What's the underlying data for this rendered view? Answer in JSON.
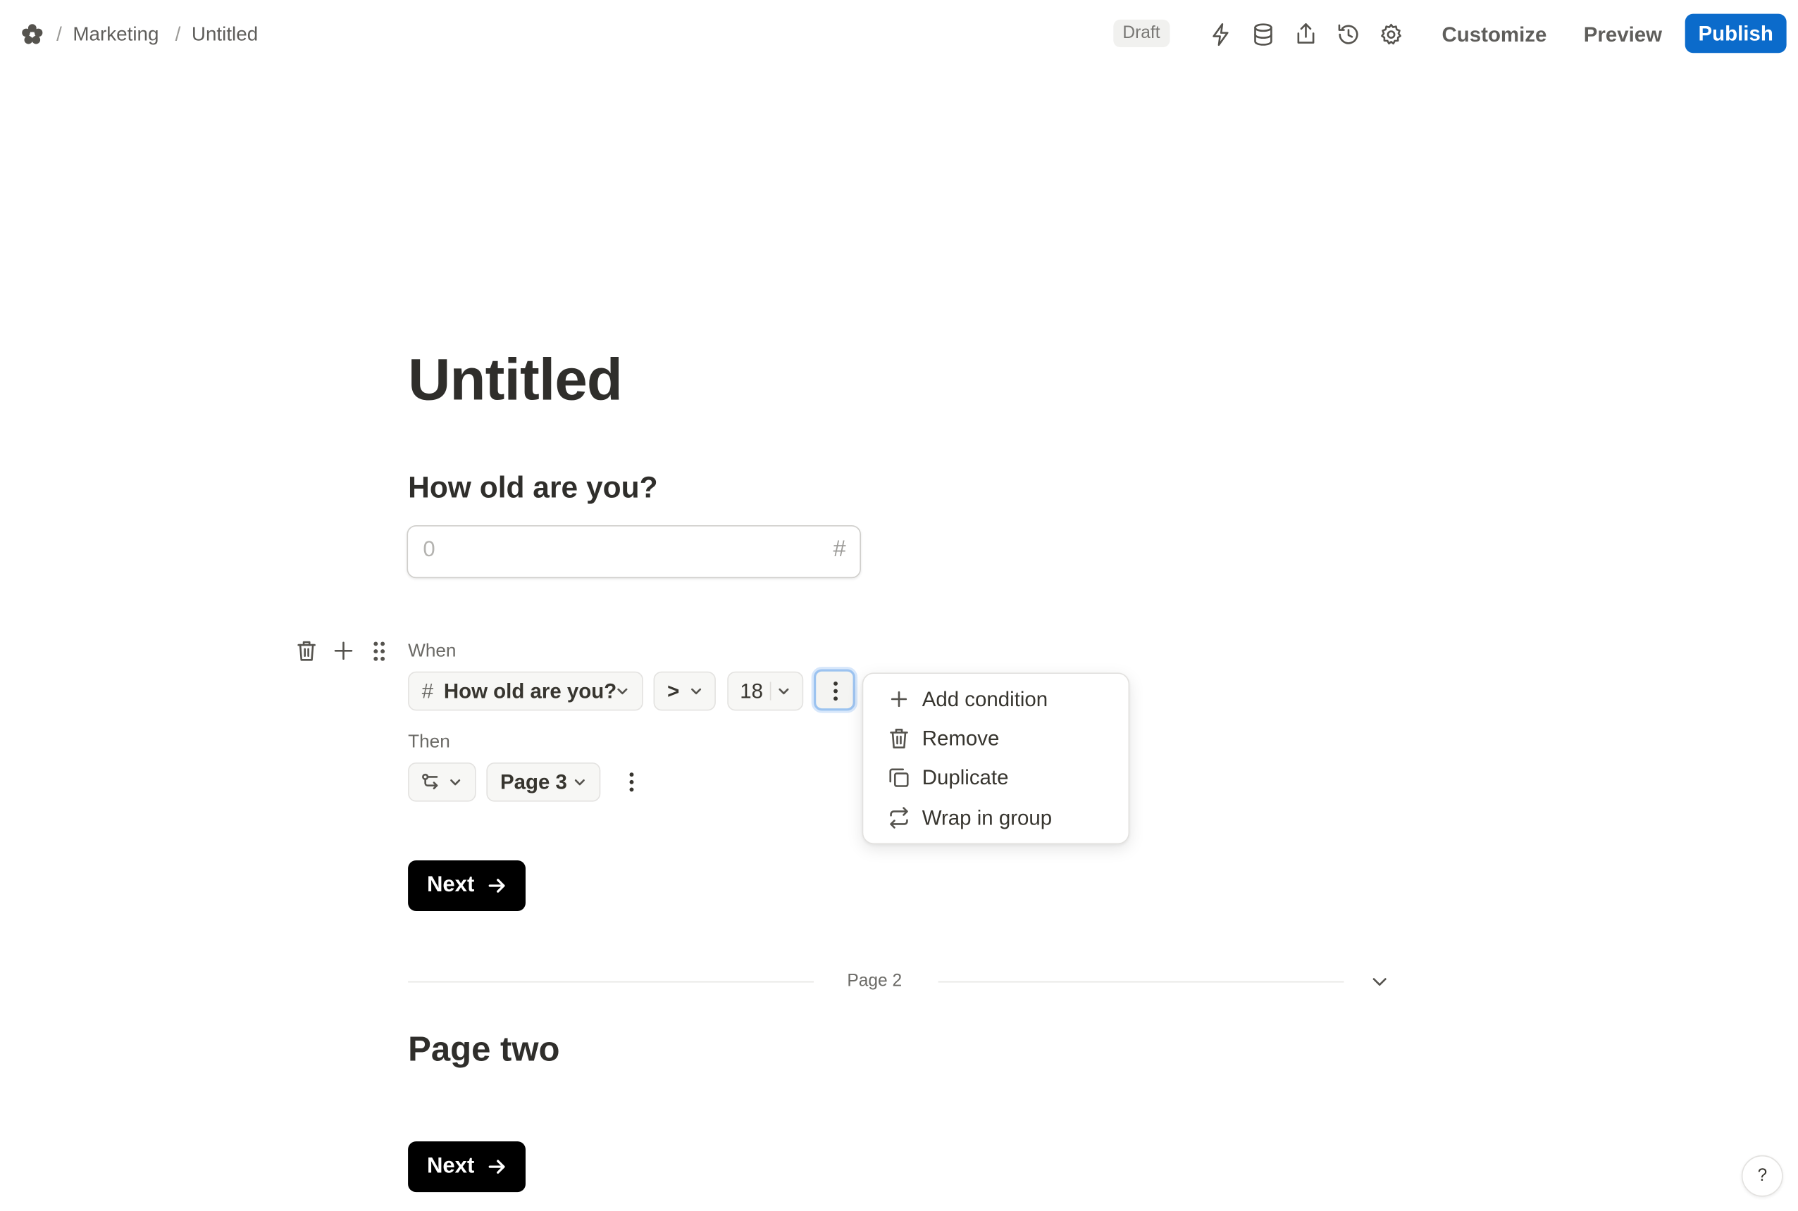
{
  "breadcrumb": {
    "workspace": "Marketing",
    "page": "Untitled"
  },
  "toolbar": {
    "status": "Draft",
    "customize_label": "Customize",
    "preview_label": "Preview",
    "publish_label": "Publish"
  },
  "form": {
    "title": "Untitled",
    "question": {
      "label": "How old are you?",
      "placeholder": "0",
      "type_symbol": "#"
    },
    "logic": {
      "when_label": "When",
      "field_symbol": "#",
      "field": "How old are you?",
      "operator": ">",
      "value": "18",
      "then_label": "Then",
      "target": "Page 3"
    },
    "context_menu": {
      "items": [
        "Add condition",
        "Remove",
        "Duplicate",
        "Wrap in group"
      ]
    },
    "next_label": "Next",
    "page_divider": "Page 2",
    "page_two_title": "Page two",
    "page_two_next_label": "Next"
  },
  "help_label": "?",
  "colors": {
    "accent": "#0b6bcb",
    "button": "#000000",
    "focus_ring": "#9cc3f0"
  },
  "icons": [
    "logo-icon",
    "bolt-icon",
    "database-icon",
    "share-icon",
    "history-icon",
    "gear-icon",
    "trash-icon",
    "plus-icon",
    "drag-handle-icon",
    "more-vertical-icon",
    "copy-icon",
    "wrap-icon",
    "branch-icon",
    "arrow-right-icon",
    "chevron-down-icon"
  ]
}
